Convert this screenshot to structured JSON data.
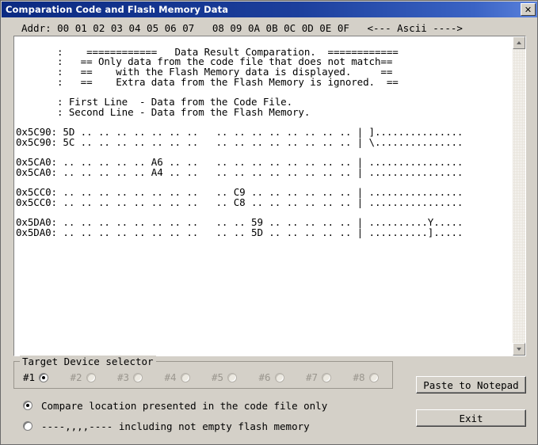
{
  "window": {
    "title": "Comparation Code and Flash Memory Data",
    "close_label": "✕"
  },
  "column_header": "Addr: 00 01 02 03 04 05 06 07   08 09 0A 0B 0C 0D 0E 0F   <--- Ascii ---->",
  "text_panel": {
    "content": "       :    ============   Data Result Comparation.  ============\n       :   == Only data from the code file that does not match==\n       :   ==    with the Flash Memory data is displayed.     ==\n       :   ==    Extra data from the Flash Memory is ignored.  ==\n\n       : First Line  - Data from the Code File.\n       : Second Line - Data from the Flash Memory.\n\n0x5C90: 5D .. .. .. .. .. .. ..   .. .. .. .. .. .. .. .. | ]...............\n0x5C90: 5C .. .. .. .. .. .. ..   .. .. .. .. .. .. .. .. | \\...............\n\n0x5CA0: .. .. .. .. .. A6 .. ..   .. .. .. .. .. .. .. .. | ................\n0x5CA0: .. .. .. .. .. A4 .. ..   .. .. .. .. .. .. .. .. | ................\n\n0x5CC0: .. .. .. .. .. .. .. ..   .. C9 .. .. .. .. .. .. | ................\n0x5CC0: .. .. .. .. .. .. .. ..   .. C8 .. .. .. .. .. .. | ................\n\n0x5DA0: .. .. .. .. .. .. .. ..   .. .. 59 .. .. .. .. .. | ..........Y.....\n0x5DA0: .. .. .. .. .. .. .. ..   .. .. 5D .. .. .. .. .. | ..........]....."
  },
  "scrollbar": {
    "up_icon": "scroll-up-arrow",
    "down_icon": "scroll-down-arrow"
  },
  "device_selector": {
    "legend": "Target Device selector",
    "items": [
      {
        "label": "#1",
        "checked": true,
        "disabled": false
      },
      {
        "label": "#2",
        "checked": false,
        "disabled": true
      },
      {
        "label": "#3",
        "checked": false,
        "disabled": true
      },
      {
        "label": "#4",
        "checked": false,
        "disabled": true
      },
      {
        "label": "#5",
        "checked": false,
        "disabled": true
      },
      {
        "label": "#6",
        "checked": false,
        "disabled": true
      },
      {
        "label": "#7",
        "checked": false,
        "disabled": true
      },
      {
        "label": "#8",
        "checked": false,
        "disabled": true
      }
    ]
  },
  "compare_options": [
    {
      "label": "Compare location presented in the code file only",
      "checked": true
    },
    {
      "label": "----,,,,---- including not empty flash memory",
      "checked": false
    }
  ],
  "buttons": {
    "paste": "Paste to Notepad",
    "exit": "Exit"
  },
  "colors": {
    "window_face": "#d4d0c8",
    "title_start": "#0b2a82",
    "title_end": "#5b82dc",
    "panel_bg": "#ffffff",
    "text": "#000000",
    "disabled_text": "#9a968e"
  }
}
